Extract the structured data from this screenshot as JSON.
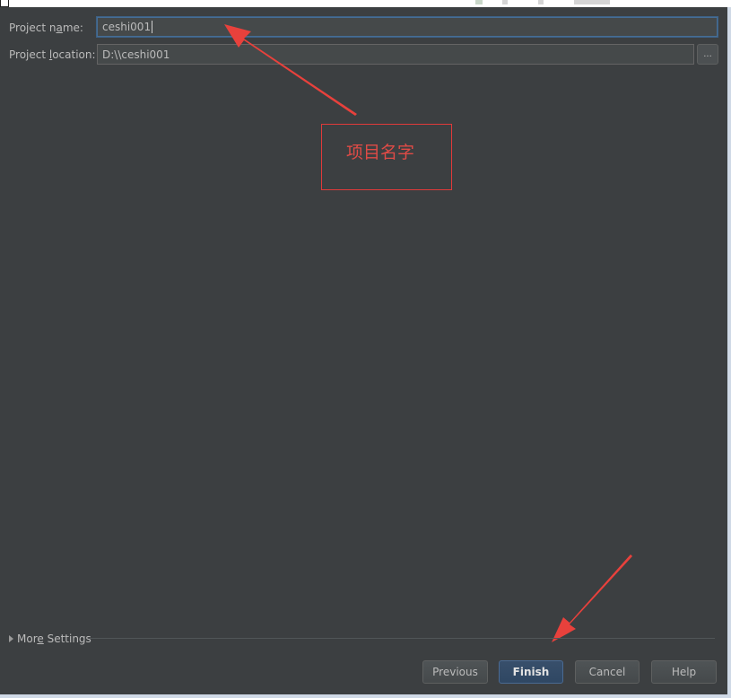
{
  "form": {
    "project_name_label_pre": "Project n",
    "project_name_label_mnemonic": "a",
    "project_name_label_post": "me:",
    "project_name_value": "ceshi001",
    "project_location_label_pre": "Project ",
    "project_location_label_mnemonic": "l",
    "project_location_label_post": "ocation:",
    "project_location_value": "D:\\\\ceshi001",
    "browse_label": "..."
  },
  "annotation": {
    "text": "项目名字",
    "color": "#e03a3a"
  },
  "more_settings": {
    "label_pre": "Mor",
    "label_mnemonic": "e",
    "label_post": " Settings"
  },
  "buttons": {
    "previous": "Previous",
    "finish": "Finish",
    "cancel": "Cancel",
    "help": "Help"
  },
  "colors": {
    "background": "#3c3f41",
    "accent_focus": "#466d94",
    "default_button": "#2f4763"
  }
}
